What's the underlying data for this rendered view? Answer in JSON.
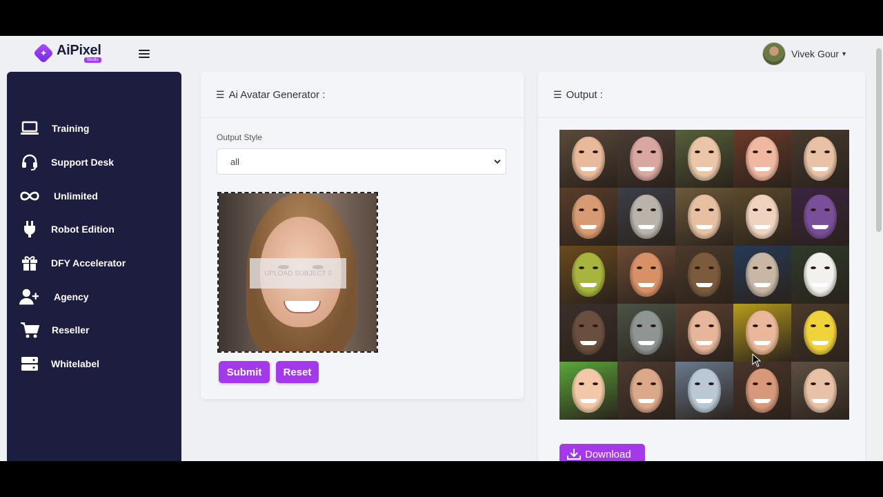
{
  "app": {
    "name": "AiPixel",
    "tagline": "Studio"
  },
  "user": {
    "name": "Vivek Gour"
  },
  "sidebar": {
    "items": [
      {
        "label": "Training",
        "icon": "laptop-icon"
      },
      {
        "label": "Support Desk",
        "icon": "headset-icon"
      },
      {
        "label": "Unlimited",
        "icon": "infinity-icon"
      },
      {
        "label": "Robot Edition",
        "icon": "plug-icon"
      },
      {
        "label": "DFY Accelerator",
        "icon": "gift-icon"
      },
      {
        "label": "Agency",
        "icon": "user-plus-icon"
      },
      {
        "label": "Reseller",
        "icon": "cart-icon"
      },
      {
        "label": "Whitelabel",
        "icon": "server-icon"
      }
    ]
  },
  "generator": {
    "title": "Ai Avatar Generator :",
    "output_style_label": "Output Style",
    "output_style_value": "all",
    "upload_label": "UPLOAD SUBJECT 0",
    "submit_label": "Submit",
    "reset_label": "Reset"
  },
  "output": {
    "title": "Output :",
    "download_label": "Download",
    "tiles": [
      {
        "bg": "#5b4a3a",
        "skin": "#e8b99a"
      },
      {
        "bg": "#4a3c34",
        "skin": "#d8a7a0"
      },
      {
        "bg": "#55603a",
        "skin": "#eac5a8"
      },
      {
        "bg": "#6b3a2a",
        "skin": "#f0b8a0"
      },
      {
        "bg": "#473a2e",
        "skin": "#e9c2a6"
      },
      {
        "bg": "#5a3d2a",
        "skin": "#d79a72"
      },
      {
        "bg": "#3c3f48",
        "skin": "#b9b3ac"
      },
      {
        "bg": "#6e5a3b",
        "skin": "#e7c0a2"
      },
      {
        "bg": "#5a4a2c",
        "skin": "#efd3c0"
      },
      {
        "bg": "#3a2440",
        "skin": "#7a4f9a"
      },
      {
        "bg": "#6a4a1c",
        "skin": "#a7b43e"
      },
      {
        "bg": "#6e4a36",
        "skin": "#d89066"
      },
      {
        "bg": "#4b3a2a",
        "skin": "#7c5a3d"
      },
      {
        "bg": "#263a56",
        "skin": "#c7b7a4"
      },
      {
        "bg": "#2e3b2a",
        "skin": "#f3f1ee"
      },
      {
        "bg": "#3b2f2a",
        "skin": "#6a4f3e"
      },
      {
        "bg": "#4a5446",
        "skin": "#8e9592"
      },
      {
        "bg": "#5a4030",
        "skin": "#e6b59a"
      },
      {
        "bg": "#b79c1c",
        "skin": "#eab79a"
      },
      {
        "bg": "#4a3a2a",
        "skin": "#f0d23a"
      },
      {
        "bg": "#5aa83a",
        "skin": "#f2c8a8"
      },
      {
        "bg": "#4d3a2e",
        "skin": "#dca88a"
      },
      {
        "bg": "#6a7a8e",
        "skin": "#b9c8d4"
      },
      {
        "bg": "#4a342a",
        "skin": "#d8987a"
      },
      {
        "bg": "#5d5042",
        "skin": "#e8c2a6"
      }
    ]
  },
  "colors": {
    "accent": "#a339e8",
    "sidebar": "#1c1d3f",
    "page": "#eef0f4"
  }
}
